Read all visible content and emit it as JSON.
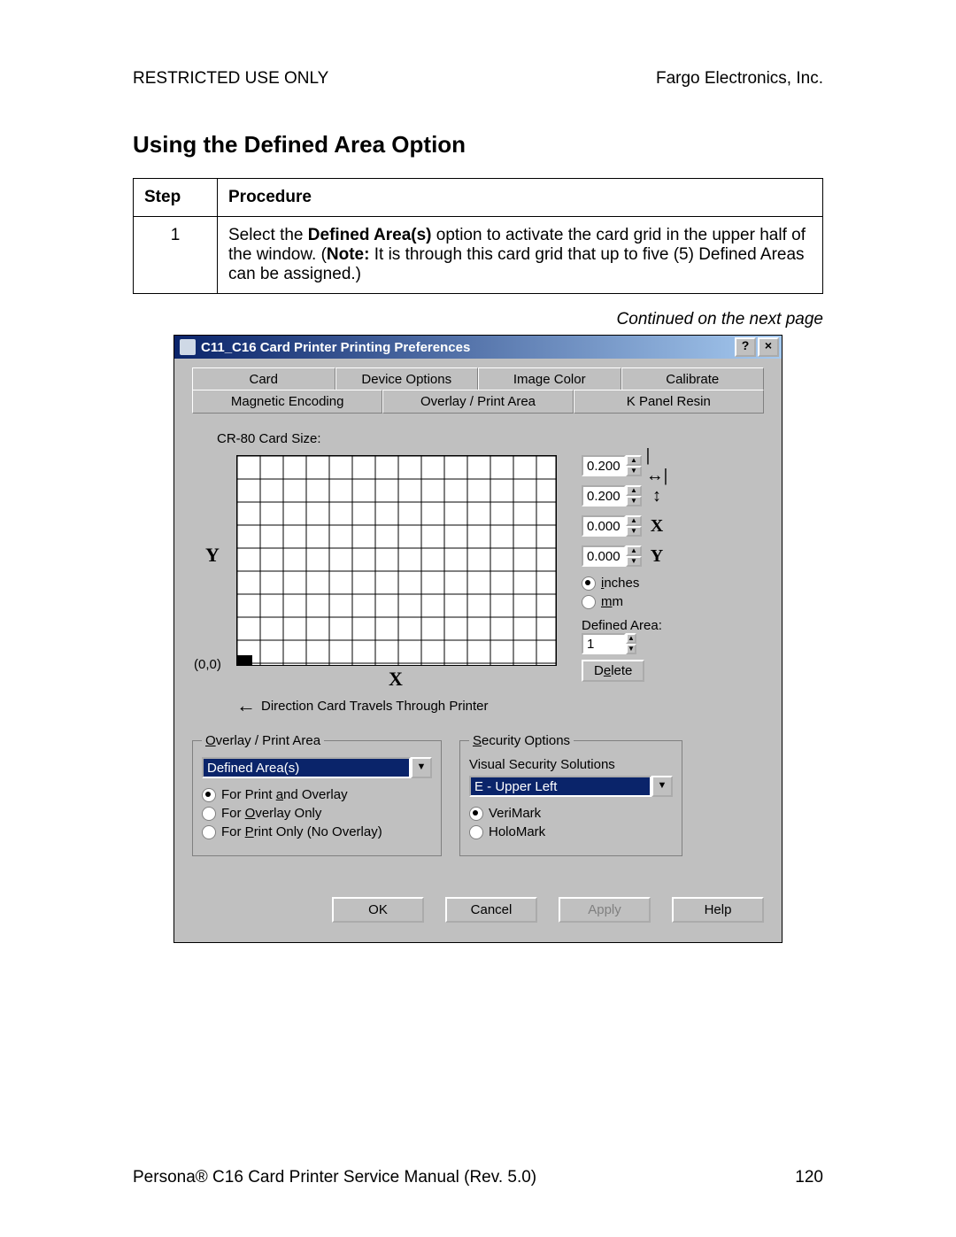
{
  "header": {
    "left": "RESTRICTED USE ONLY",
    "right": "Fargo Electronics, Inc."
  },
  "heading": "Using the Defined Area Option",
  "table": {
    "step_hdr": "Step",
    "proc_hdr": "Procedure",
    "step_num": "1",
    "proc_pre": "Select the ",
    "proc_bold1": "Defined Area(s)",
    "proc_mid": " option to activate the card grid in the upper half of the window. (",
    "proc_bold2": "Note:",
    "proc_post": "  It is through this card grid that up to five (5) Defined Areas can be assigned.)"
  },
  "continued": "Continued on the next page",
  "dialog": {
    "title": "C11_C16 Card Printer Printing Preferences",
    "help_btn": "?",
    "close_btn": "×",
    "tabs_top": [
      "Card",
      "Device Options",
      "Image Color",
      "Calibrate"
    ],
    "tabs_bottom": [
      "Magnetic Encoding",
      "Overlay / Print Area",
      "K Panel Resin"
    ],
    "card_size_label": "CR-80 Card Size:",
    "y_label": "Y",
    "x_label": "X",
    "origin": "(0,0)",
    "direction": "Direction Card Travels Through Printer",
    "spins": {
      "w": "0.200",
      "h": "0.200",
      "x": "0.000",
      "y": "0.000"
    },
    "dim_labels": {
      "w": "↔",
      "h": "↕",
      "x": "X",
      "y": "Y"
    },
    "units": {
      "inches_i": "i",
      "inches_rest": "nches",
      "mm_m": "m",
      "mm_rest": "m"
    },
    "defined_area_label": "Defined Area:",
    "defined_area_value": "1",
    "delete_d": "D",
    "delete_e": "e",
    "delete_rest": "lete",
    "group1": {
      "legend_o": "O",
      "legend_rest": "verlay / Print Area",
      "combo": "Defined Area(s)",
      "r1_pre": "For Print ",
      "r1_a": "a",
      "r1_post": "nd Overlay",
      "r2_pre": "For ",
      "r2_o": "O",
      "r2_post": "verlay Only",
      "r3_pre": "For ",
      "r3_p": "P",
      "r3_post": "rint Only (No Overlay)"
    },
    "group2": {
      "legend_s": "S",
      "legend_rest": "ecurity Options",
      "vss": "Visual Security Solutions",
      "combo": "E - Upper Left",
      "r1": "VeriMark",
      "r2": "HoloMark"
    },
    "buttons": {
      "ok": "OK",
      "cancel": "Cancel",
      "apply": "Apply",
      "help": "Help"
    }
  },
  "footer": {
    "left_pre": "Persona",
    "left_reg": "®",
    "left_post": " C16 Card Printer Service Manual (Rev.  5.0)",
    "page": "120"
  }
}
